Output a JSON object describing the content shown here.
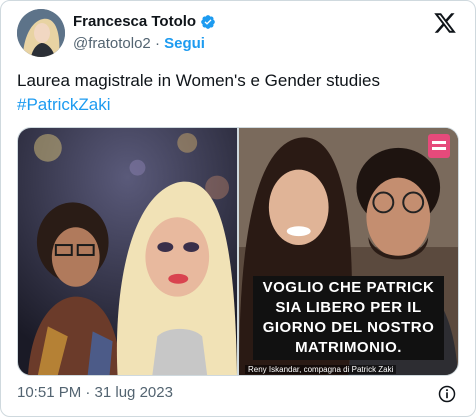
{
  "author": {
    "name": "Francesca Totolo",
    "handle": "@fratotolo2",
    "separator": " · ",
    "follow_label": "Segui"
  },
  "icons": {
    "verified": "verified-badge-icon",
    "platform": "x-logo-icon",
    "info": "info-icon"
  },
  "tweet": {
    "text": "Laurea magistrale in Women's e Gender studies",
    "hashtag": "#PatrickZaki"
  },
  "media": {
    "right_photo_caption": "VOGLIO CHE PATRICK SIA LIBERO PER IL GIORNO DEL NOSTRO MATRIMONIO.",
    "right_photo_credit": "Reny Iskandar, compagna di Patrick Zaki"
  },
  "footer": {
    "timestamp": "10:51 PM · 31 lug 2023"
  },
  "colors": {
    "accent": "#1d9bf0",
    "text": "#0f1419",
    "secondary": "#536471",
    "border": "#cfd9de"
  }
}
